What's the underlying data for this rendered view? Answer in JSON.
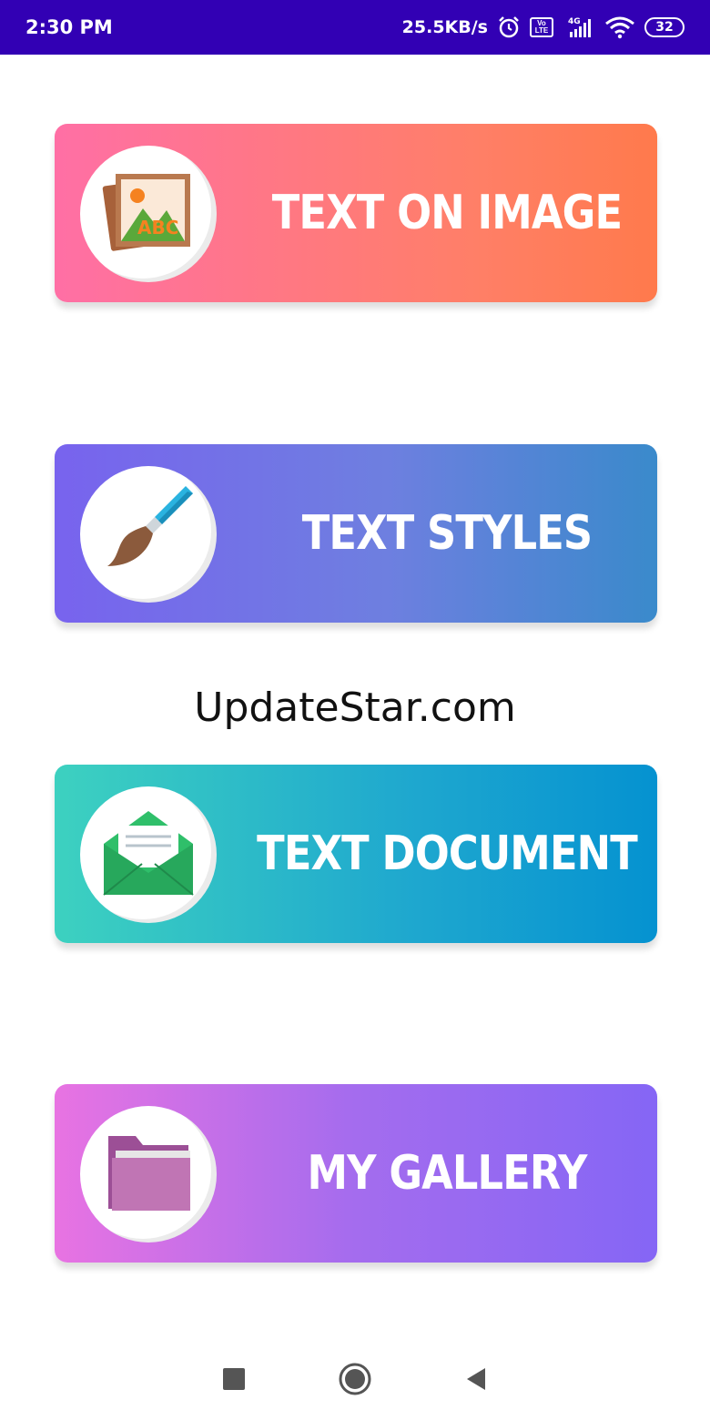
{
  "status_bar": {
    "time": "2:30 PM",
    "network_speed": "25.5KB/s",
    "volte_label": "Vo\nLTE",
    "network_type": "4G",
    "battery_level": "32",
    "icons": [
      "alarm-icon",
      "volte-icon",
      "signal-icon",
      "wifi-icon",
      "battery-icon"
    ]
  },
  "menu": {
    "items": [
      {
        "label": "TEXT ON IMAGE",
        "icon": "image-text-icon",
        "colors": [
          "#ff6fa5",
          "#ff7a4c"
        ]
      },
      {
        "label": "TEXT STYLES",
        "icon": "paintbrush-icon",
        "colors": [
          "#7863ee",
          "#3a8acb"
        ]
      },
      {
        "label": "TEXT DOCUMENT",
        "icon": "envelope-icon",
        "colors": [
          "#3dd1c0",
          "#0592d0"
        ]
      },
      {
        "label": "MY GALLERY",
        "icon": "folder-icon",
        "colors": [
          "#e873e2",
          "#8566f5"
        ]
      }
    ]
  },
  "watermark": "UpdateStar.com",
  "nav_bar": {
    "icons": [
      "recents-square-icon",
      "home-circle-icon",
      "back-triangle-icon"
    ]
  },
  "colors": {
    "status_bar": "#3200b4",
    "background": "#ffffff"
  }
}
